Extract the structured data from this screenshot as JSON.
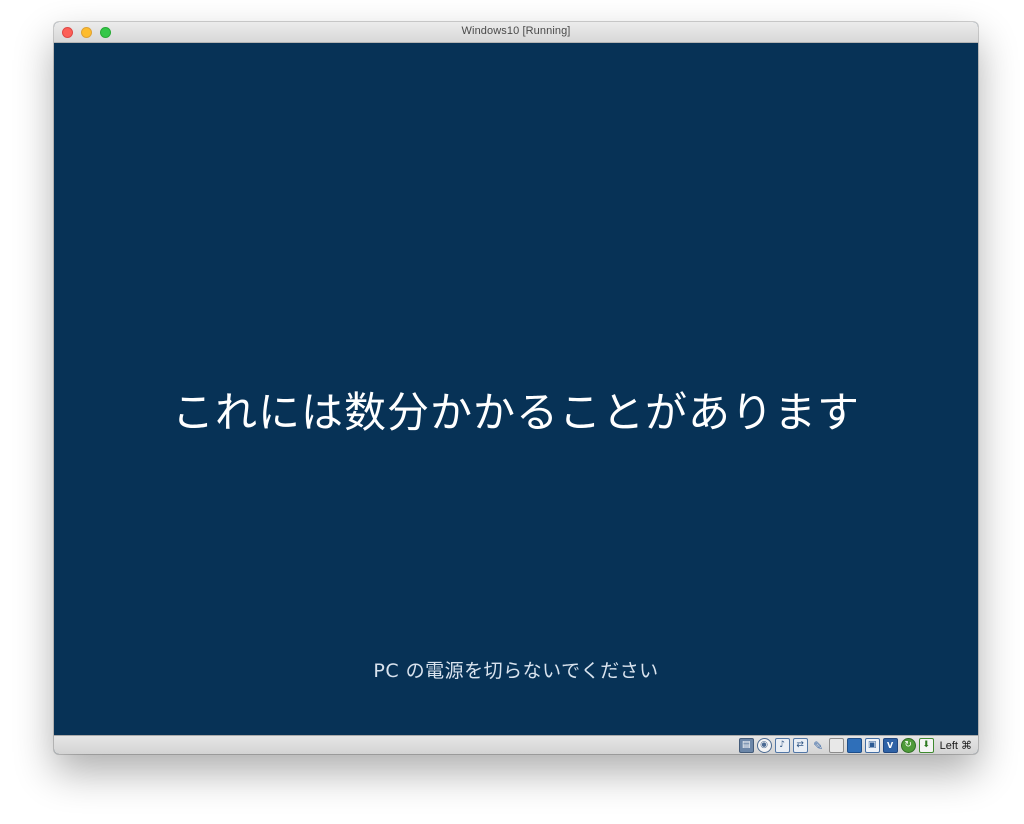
{
  "window": {
    "title": "Windows10 [Running]"
  },
  "screen": {
    "main_message": "これには数分かかることがあります",
    "sub_message": "PC の電源を切らないでください",
    "background_color": "#073256"
  },
  "statusbar": {
    "icons": [
      "hard-disk-icon",
      "optical-drive-icon",
      "audio-icon",
      "network-icon",
      "usb-icon",
      "shared-folders-icon",
      "display-icon",
      "video-capture-icon",
      "cpu-icon",
      "mouse-integration-icon",
      "keyboard-capture-icon"
    ],
    "host_key": "Left ⌘"
  }
}
